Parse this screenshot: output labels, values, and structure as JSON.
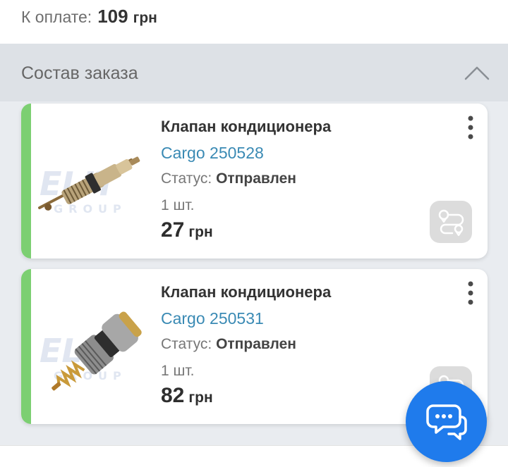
{
  "total": {
    "label": "К оплате:",
    "amount": "109",
    "currency": "грн"
  },
  "order_section": {
    "title": "Состав заказа"
  },
  "items": [
    {
      "name": "Клапан кондиционера",
      "cargo": "Cargo 250528",
      "status_label": "Статус:",
      "status_value": "Отправлен",
      "quantity": "1 шт.",
      "price": "27",
      "currency": "грн",
      "watermark": "ELIT GROUP"
    },
    {
      "name": "Клапан кондиционера",
      "cargo": "Cargo 250531",
      "status_label": "Статус:",
      "status_value": "Отправлен",
      "quantity": "1 шт.",
      "price": "82",
      "currency": "грн",
      "watermark": "ELIT GROUP"
    }
  ],
  "colors": {
    "accent_stripe": "#7ccf72",
    "link": "#3a8ab4",
    "fab": "#1f7bec"
  },
  "icons": {
    "collapse": "chevron-up-icon",
    "menu": "more-vertical-icon",
    "route": "route-map-icon",
    "chat": "chat-icon"
  }
}
